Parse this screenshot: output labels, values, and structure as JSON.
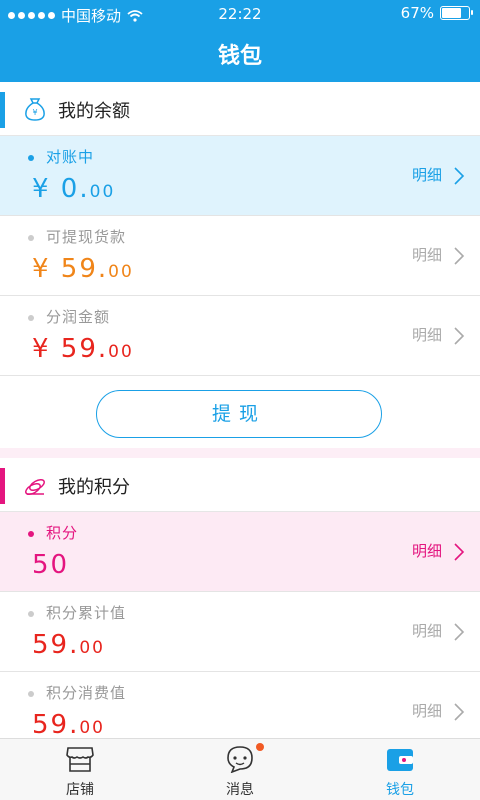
{
  "status": {
    "carrier": "中国移动",
    "time": "22:22",
    "battery_text": "67%",
    "battery_level": 0.67
  },
  "header": {
    "title": "钱包"
  },
  "balance": {
    "title": "我的余额",
    "accent": "#1aa0e6",
    "rows": [
      {
        "name": "对账中",
        "amount_int": "¥ 0.",
        "amount_dec": "00",
        "detail": "明细",
        "color": "#1aa0e6",
        "highlight": "#dff3fd"
      },
      {
        "name": "可提现货款",
        "amount_int": "¥ 59.",
        "amount_dec": "00",
        "detail": "明细",
        "color": "#f08519",
        "highlight": ""
      },
      {
        "name": "分润金额",
        "amount_int": "¥ 59.",
        "amount_dec": "00",
        "detail": "明细",
        "color": "#e8251e",
        "highlight": ""
      }
    ],
    "withdraw_label": "提现"
  },
  "points": {
    "title": "我的积分",
    "accent": "#e4157f",
    "rows": [
      {
        "name": "积分",
        "amount_int": "50",
        "amount_dec": "",
        "detail": "明细",
        "color": "#e4157f",
        "highlight": "#fdeaf4"
      },
      {
        "name": "积分累计值",
        "amount_int": "59.",
        "amount_dec": "00",
        "detail": "明细",
        "color": "#e8251e",
        "highlight": ""
      },
      {
        "name": "积分消费值",
        "amount_int": "59.",
        "amount_dec": "00",
        "detail": "明细",
        "color": "#e8251e",
        "highlight": ""
      }
    ]
  },
  "tabs": [
    {
      "label": "店铺",
      "icon": "store-icon",
      "active": false
    },
    {
      "label": "消息",
      "icon": "message-icon",
      "active": false
    },
    {
      "label": "钱包",
      "icon": "wallet-icon",
      "active": true
    }
  ],
  "tab_active_color": "#1aa0e6"
}
